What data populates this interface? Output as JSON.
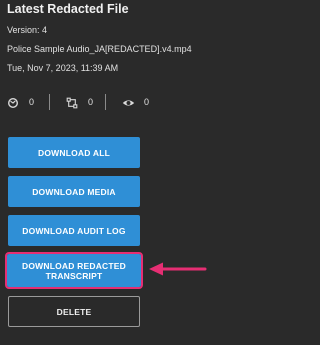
{
  "panel": {
    "title": "Latest Redacted File",
    "version": "Version: 4",
    "filename": "Police Sample Audio_JA[REDACTED].v4.mp4",
    "timestamp": "Tue, Nov 7, 2023, 11:39 AM"
  },
  "stats": [
    {
      "icon": "refresh-icon",
      "value": "0"
    },
    {
      "icon": "edit-icon",
      "value": "0"
    },
    {
      "icon": "eye-icon",
      "value": "0"
    }
  ],
  "buttons": {
    "download_all": "DOWNLOAD ALL",
    "download_media": "DOWNLOAD MEDIA",
    "download_audit_log": "DOWNLOAD AUDIT LOG",
    "download_redacted_transcript_line1": "DOWNLOAD REDACTED",
    "download_redacted_transcript_line2": "TRANSCRIPT",
    "delete": "DELETE"
  },
  "colors": {
    "background": "#2a2a2a",
    "primary_button": "#2f8fd6",
    "highlight": "#e62e73"
  },
  "annotation": {
    "arrow_icon": "pointer-arrow-icon"
  }
}
